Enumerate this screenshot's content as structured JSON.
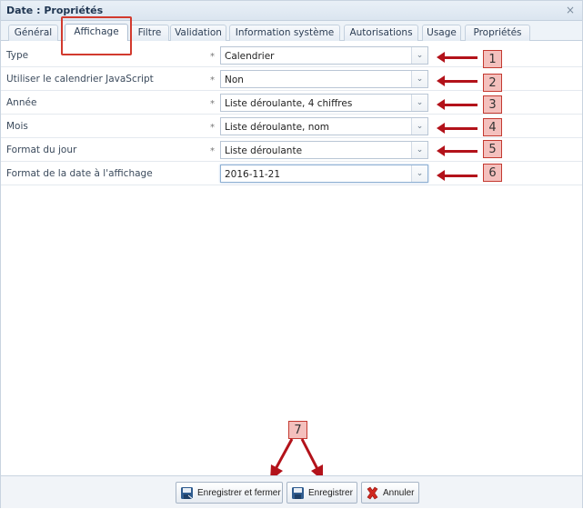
{
  "window": {
    "title": "Date : Propriétés",
    "close_glyph": "×"
  },
  "tabs": [
    {
      "label": "Général",
      "active": false
    },
    {
      "label": "Affichage",
      "active": true
    },
    {
      "label": "Filtre",
      "active": false
    },
    {
      "label": "Validation",
      "active": false
    },
    {
      "label": "Information système",
      "active": false
    },
    {
      "label": "Autorisations",
      "active": false
    },
    {
      "label": "Usage",
      "active": false
    },
    {
      "label": "Propriétés",
      "active": false
    }
  ],
  "fields": [
    {
      "label": "Type",
      "required": "*",
      "value": "Calendrier",
      "callout": "1"
    },
    {
      "label": "Utiliser le calendrier JavaScript",
      "required": "*",
      "value": "Non",
      "callout": "2"
    },
    {
      "label": "Année",
      "required": "*",
      "value": "Liste déroulante, 4 chiffres",
      "callout": "3"
    },
    {
      "label": "Mois",
      "required": "*",
      "value": "Liste déroulante, nom",
      "callout": "4"
    },
    {
      "label": "Format du jour",
      "required": "*",
      "value": "Liste déroulante",
      "callout": "5"
    },
    {
      "label": "Format de la date à l'affichage",
      "required": "",
      "value": "2016-11-21",
      "callout": "6"
    }
  ],
  "footer": {
    "callout": "7",
    "buttons": [
      {
        "label": "Enregistrer et fermer",
        "icon": "save-close-icon"
      },
      {
        "label": "Enregistrer",
        "icon": "save-icon"
      },
      {
        "label": "Annuler",
        "icon": "cancel-icon"
      }
    ]
  },
  "colors": {
    "annotation_red": "#b3121a",
    "callout_fill": "#f4c0bd"
  }
}
